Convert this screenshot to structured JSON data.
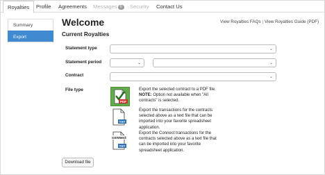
{
  "nav": {
    "tabs": [
      {
        "label": "Royalties"
      },
      {
        "label": "Profile"
      },
      {
        "label": "Agreements"
      },
      {
        "label": "Messages",
        "badge": "0"
      },
      {
        "label": "Security"
      },
      {
        "label": "Contact Us"
      }
    ]
  },
  "sidebar": {
    "items": [
      {
        "label": "Summary"
      },
      {
        "label": "Export"
      }
    ]
  },
  "header": {
    "title": "Welcome",
    "faq_link": "View Royalties FAQs",
    "separator": "|",
    "guide_link": "View Royalties Guide (PDF)"
  },
  "main": {
    "subtitle": "Current Royalties",
    "statement_type_label": "Statement type",
    "statement_period_label": "Statement period",
    "contract_label": "Contract",
    "file_type_label": "File type",
    "options": {
      "pdf_line1": "Export the selected contract to a PDF file.",
      "pdf_note_bold": "NOTE:",
      "pdf_note_rest": " Option not available when \"All contracts\" is selected.",
      "txt": "Export the transactions for the contracts selected above as a text file that can be imported into your favorite spreadsheet application.",
      "connect": "Export the Connect transactions for the contracts selected above as a text file that can be imported into your favorite spreadsheet application."
    },
    "download_label": "Download file",
    "icon_labels": {
      "pdf": "PDF",
      "txt": "TXT",
      "connect_word": "connect",
      "connect_txt": "TXT"
    }
  },
  "colors": {
    "accent": "#3f8ad0",
    "pdf_green": "#62ab4a",
    "pdf_red": "#d0312d",
    "txt_blue": "#2f6fb3"
  }
}
